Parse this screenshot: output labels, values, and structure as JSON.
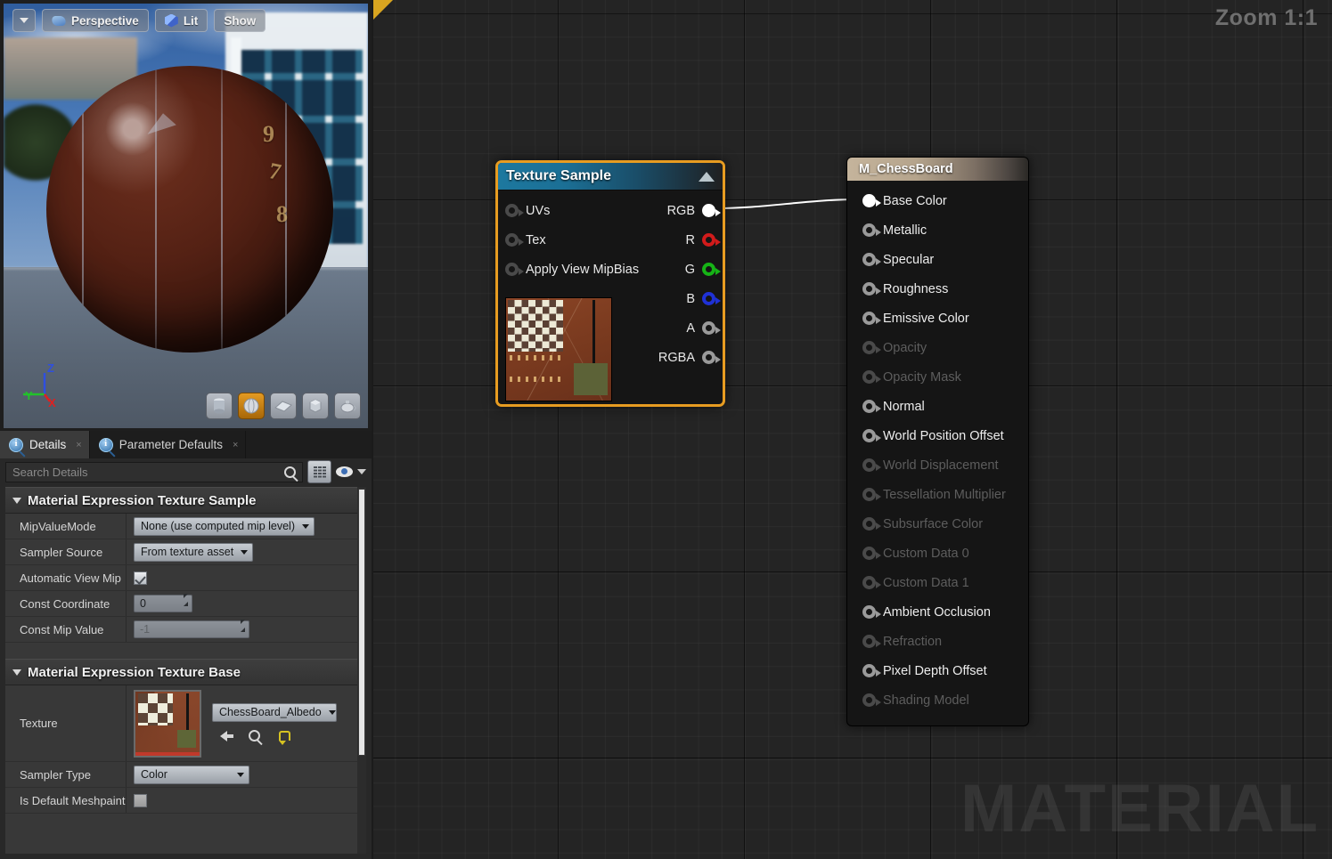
{
  "viewport": {
    "toolbar": {
      "menu_caret": "menu-caret",
      "perspective_label": "Perspective",
      "lit_label": "Lit",
      "show_label": "Show"
    },
    "gizmo": {
      "x": "X",
      "y": "Y",
      "z": "Z"
    },
    "sphere_numbers": [
      "9",
      "7",
      "8"
    ],
    "shape_buttons": [
      {
        "name": "cylinder",
        "active": false
      },
      {
        "name": "sphere",
        "active": true
      },
      {
        "name": "plane",
        "active": false
      },
      {
        "name": "cube",
        "active": false
      },
      {
        "name": "teapot",
        "active": false
      }
    ]
  },
  "details": {
    "tabs": [
      {
        "label": "Details",
        "icon": "info-icon",
        "active": true,
        "close": "×"
      },
      {
        "label": "Parameter Defaults",
        "icon": "info-icon",
        "active": false,
        "close": "×"
      }
    ],
    "search": {
      "placeholder": "Search Details",
      "value": ""
    },
    "toolbar_icons": [
      "search-icon",
      "grid-view-icon",
      "eye-icon",
      "chevron-down-icon"
    ],
    "categories": [
      {
        "title": "Material Expression Texture Sample",
        "rows": [
          {
            "label": "MipValueMode",
            "type": "combo",
            "value": "None (use computed mip level)"
          },
          {
            "label": "Sampler Source",
            "type": "combo",
            "value": "From texture asset"
          },
          {
            "label": "Automatic View Mip",
            "type": "checkbox",
            "value": "checked"
          },
          {
            "label": "Const Coordinate",
            "type": "number",
            "value": "0"
          },
          {
            "label": "Const Mip Value",
            "type": "number-disabled",
            "value": "-1"
          }
        ]
      },
      {
        "title": "Material Expression Texture Base",
        "rows": [
          {
            "label": "Texture",
            "type": "asset",
            "value": "ChessBoard_Albedo"
          },
          {
            "label": "Sampler Type",
            "type": "combo",
            "value": "Color"
          },
          {
            "label": "Is Default Meshpaint",
            "type": "checkbox-empty",
            "value": ""
          }
        ]
      }
    ],
    "asset_action_icons": [
      "use-selected-asset-icon",
      "browse-asset-icon",
      "reset-to-default-icon"
    ]
  },
  "graph": {
    "zoom_label": "Zoom 1:1",
    "watermark": "MATERIAL",
    "nodes": {
      "texture_sample": {
        "title": "Texture Sample",
        "collapse_icon": "triangle-up-icon",
        "inputs": [
          {
            "label": "UVs",
            "pin": "darkgrey"
          },
          {
            "label": "Tex",
            "pin": "darkgrey"
          },
          {
            "label": "Apply View MipBias",
            "pin": "darkgrey"
          }
        ],
        "outputs": [
          {
            "label": "RGB",
            "pin": "white"
          },
          {
            "label": "R",
            "pin": "red"
          },
          {
            "label": "G",
            "pin": "green"
          },
          {
            "label": "B",
            "pin": "blue"
          },
          {
            "label": "A",
            "pin": "grey"
          },
          {
            "label": "RGBA",
            "pin": "grey"
          }
        ],
        "thumbnail": "chessboard-texture-thumbnail",
        "selected": true,
        "selection_color": "#e79c21"
      },
      "material": {
        "title": "M_ChessBoard",
        "pins": [
          {
            "label": "Base Color",
            "enabled": true,
            "connected": true
          },
          {
            "label": "Metallic",
            "enabled": true,
            "connected": false
          },
          {
            "label": "Specular",
            "enabled": true,
            "connected": false
          },
          {
            "label": "Roughness",
            "enabled": true,
            "connected": false
          },
          {
            "label": "Emissive Color",
            "enabled": true,
            "connected": false
          },
          {
            "label": "Opacity",
            "enabled": false,
            "connected": false
          },
          {
            "label": "Opacity Mask",
            "enabled": false,
            "connected": false
          },
          {
            "label": "Normal",
            "enabled": true,
            "connected": false
          },
          {
            "label": "World Position Offset",
            "enabled": true,
            "connected": false
          },
          {
            "label": "World Displacement",
            "enabled": false,
            "connected": false
          },
          {
            "label": "Tessellation Multiplier",
            "enabled": false,
            "connected": false
          },
          {
            "label": "Subsurface Color",
            "enabled": false,
            "connected": false
          },
          {
            "label": "Custom Data 0",
            "enabled": false,
            "connected": false
          },
          {
            "label": "Custom Data 1",
            "enabled": false,
            "connected": false
          },
          {
            "label": "Ambient Occlusion",
            "enabled": true,
            "connected": false
          },
          {
            "label": "Refraction",
            "enabled": false,
            "connected": false
          },
          {
            "label": "Pixel Depth Offset",
            "enabled": true,
            "connected": false
          },
          {
            "label": "Shading Model",
            "enabled": false,
            "connected": false
          }
        ]
      }
    },
    "connection": {
      "from": "RGB",
      "to": "Base Color",
      "color": "#ffffff"
    }
  },
  "colors": {
    "selection": "#e79c21",
    "graph_bg": "#242424",
    "node_header_texsample": "#1d789f",
    "node_header_material": "#c5b49c",
    "pin_red": "#d11b1b",
    "pin_green": "#16b316",
    "pin_blue": "#1f31d6"
  }
}
